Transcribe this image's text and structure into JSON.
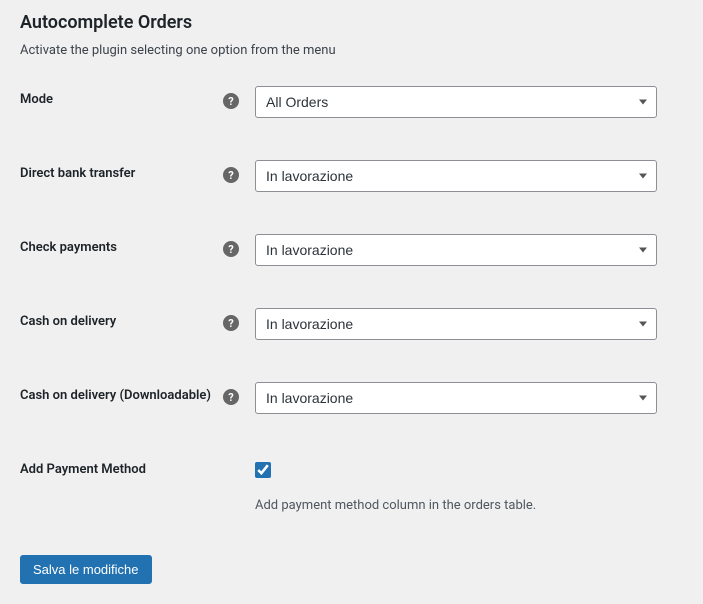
{
  "header": {
    "title": "Autocomplete Orders",
    "subtitle": "Activate the plugin selecting one option from the menu"
  },
  "fields": {
    "mode": {
      "label": "Mode",
      "value": "All Orders"
    },
    "direct_bank": {
      "label": "Direct bank transfer",
      "value": "In lavorazione"
    },
    "check_payments": {
      "label": "Check payments",
      "value": "In lavorazione"
    },
    "cash_on_delivery": {
      "label": "Cash on delivery",
      "value": "In lavorazione"
    },
    "cash_on_delivery_dl": {
      "label": "Cash on delivery (Downloadable)",
      "value": "In lavorazione"
    },
    "add_payment_method": {
      "label": "Add Payment Method",
      "description": "Add payment method column in the orders table."
    }
  },
  "buttons": {
    "submit": "Salva le modifiche"
  }
}
